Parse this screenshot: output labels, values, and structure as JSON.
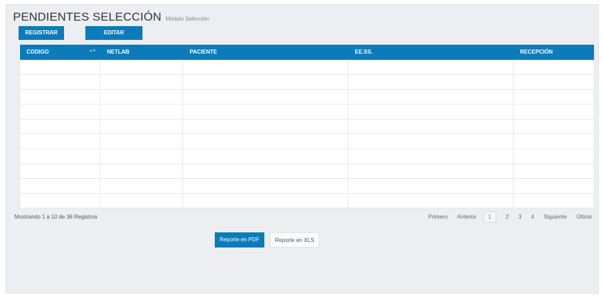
{
  "header": {
    "title": "PENDIENTES SELECCIÓN",
    "subtitle": "Módulo Selección"
  },
  "toolbar": {
    "register_label": "REGISTRAR",
    "edit_label": "EDITAR"
  },
  "table": {
    "columns": [
      "CODIGO",
      "NETLAB",
      "PACIENTE",
      "EE.SS.",
      "RECEPCIÓN"
    ],
    "sort_icon": "sort-icon",
    "rows": [
      [
        "",
        "",
        "",
        "",
        ""
      ],
      [
        "",
        "",
        "",
        "",
        ""
      ],
      [
        "",
        "",
        "",
        "",
        ""
      ],
      [
        "",
        "",
        "",
        "",
        ""
      ],
      [
        "",
        "",
        "",
        "",
        ""
      ],
      [
        "",
        "",
        "",
        "",
        ""
      ],
      [
        "",
        "",
        "",
        "",
        ""
      ],
      [
        "",
        "",
        "",
        "",
        ""
      ],
      [
        "",
        "",
        "",
        "",
        ""
      ],
      [
        "",
        "",
        "",
        "",
        ""
      ]
    ]
  },
  "footer": {
    "info": "Mostrando 1 a 10 de 36 Registros"
  },
  "pagination": {
    "first": "Primero",
    "previous": "Anterior",
    "pages": [
      "1",
      "2",
      "3",
      "4"
    ],
    "current_page": "1",
    "next": "Siguiente",
    "last": "Último"
  },
  "reports": {
    "pdf_label": "Reporte en PDF",
    "xls_label": "Reporte en XLS"
  },
  "colors": {
    "accent": "#0c7bb9",
    "panel_background": "#eceef2"
  }
}
